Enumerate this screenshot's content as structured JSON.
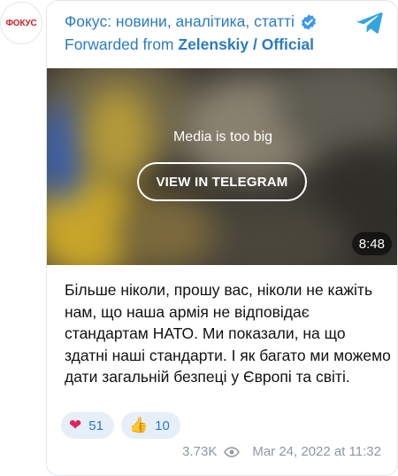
{
  "avatar": {
    "text": "ФОКУС"
  },
  "header": {
    "channel_name": "Фокус: новини, аналітика, статті",
    "forwarded_prefix": "Forwarded from ",
    "forwarded_source": "Zelenskiy / Official"
  },
  "media": {
    "notice": "Media is too big",
    "button_label": "VIEW IN TELEGRAM",
    "duration": "8:48"
  },
  "message": {
    "text": "Більше ніколи, прошу вас, ніколи не кажіть нам, що наша армія не відповідає стандартам НАТО. Ми показали, на що здатні наші стандарти. І як багато ми можемо дати загальній безпеці у Європі та світі."
  },
  "reactions": [
    {
      "emoji": "❤",
      "icon": "heart-icon",
      "count": "51"
    },
    {
      "emoji": "👍",
      "icon": "thumbs-up-icon",
      "count": "10"
    }
  ],
  "meta": {
    "views": "3.73K",
    "date": "Mar 24, 2022 at 11:32"
  },
  "colors": {
    "link": "#2b7bc4",
    "verified": "#3d9ae8",
    "telegram": "#34a4e0",
    "reaction_bg": "#e6eef7",
    "meta_text": "#8c98a4",
    "avatar_text": "#d11f2b"
  }
}
